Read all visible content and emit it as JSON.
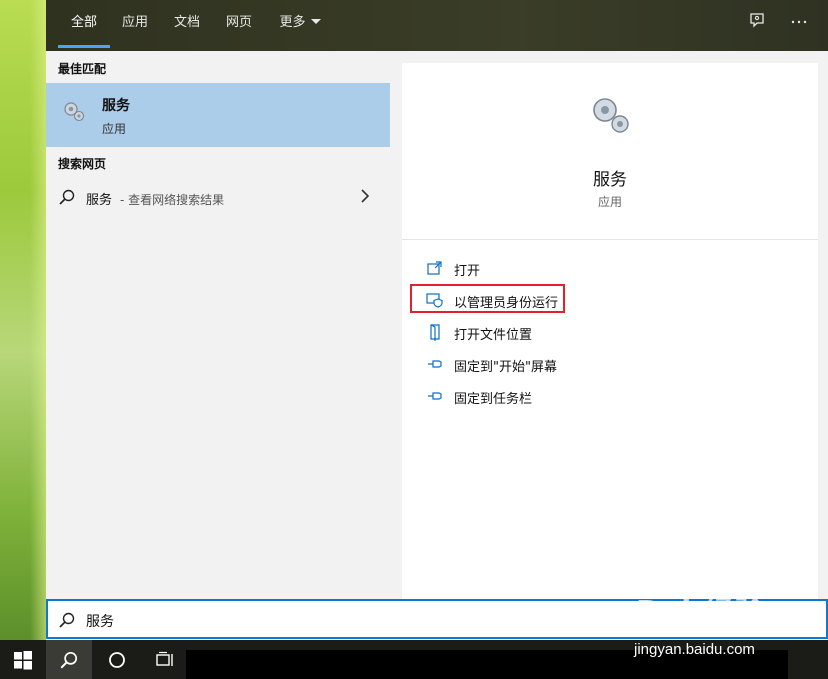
{
  "tabs": [
    {
      "label": "全部",
      "active": true
    },
    {
      "label": "应用",
      "active": false
    },
    {
      "label": "文档",
      "active": false
    },
    {
      "label": "网页",
      "active": false
    },
    {
      "label": "更多",
      "active": false
    }
  ],
  "topbar_icons": [
    "feedback-icon",
    "more-options-icon"
  ],
  "left": {
    "best_match_title": "最佳匹配",
    "best_match": {
      "name": "服务",
      "type": "应用",
      "icon": "gears-icon"
    },
    "web_title": "搜索网页",
    "web_result": {
      "term": "服务",
      "desc": "- 查看网络搜索结果"
    }
  },
  "detail": {
    "name": "服务",
    "type": "应用",
    "actions": [
      {
        "label": "打开",
        "icon": "open-icon"
      },
      {
        "label": "以管理员身份运行",
        "icon": "shield-admin-icon",
        "highlighted": true
      },
      {
        "label": "打开文件位置",
        "icon": "folder-location-icon"
      },
      {
        "label": "固定到\"开始\"屏幕",
        "icon": "pin-icon"
      },
      {
        "label": "固定到任务栏",
        "icon": "pin-icon"
      }
    ]
  },
  "search": {
    "query": "服务"
  },
  "taskbar": {
    "items": [
      "windows-start-icon",
      "search-icon",
      "cortana-icon",
      "task-view-icon"
    ]
  },
  "watermark": {
    "logo": "Bai 经验",
    "url": "jingyan.baidu.com"
  },
  "colors": {
    "accent": "#0a78d4",
    "selected": "#abcde9",
    "highlight_border": "#e0222d",
    "tab_underline": "#4ba3ff"
  }
}
